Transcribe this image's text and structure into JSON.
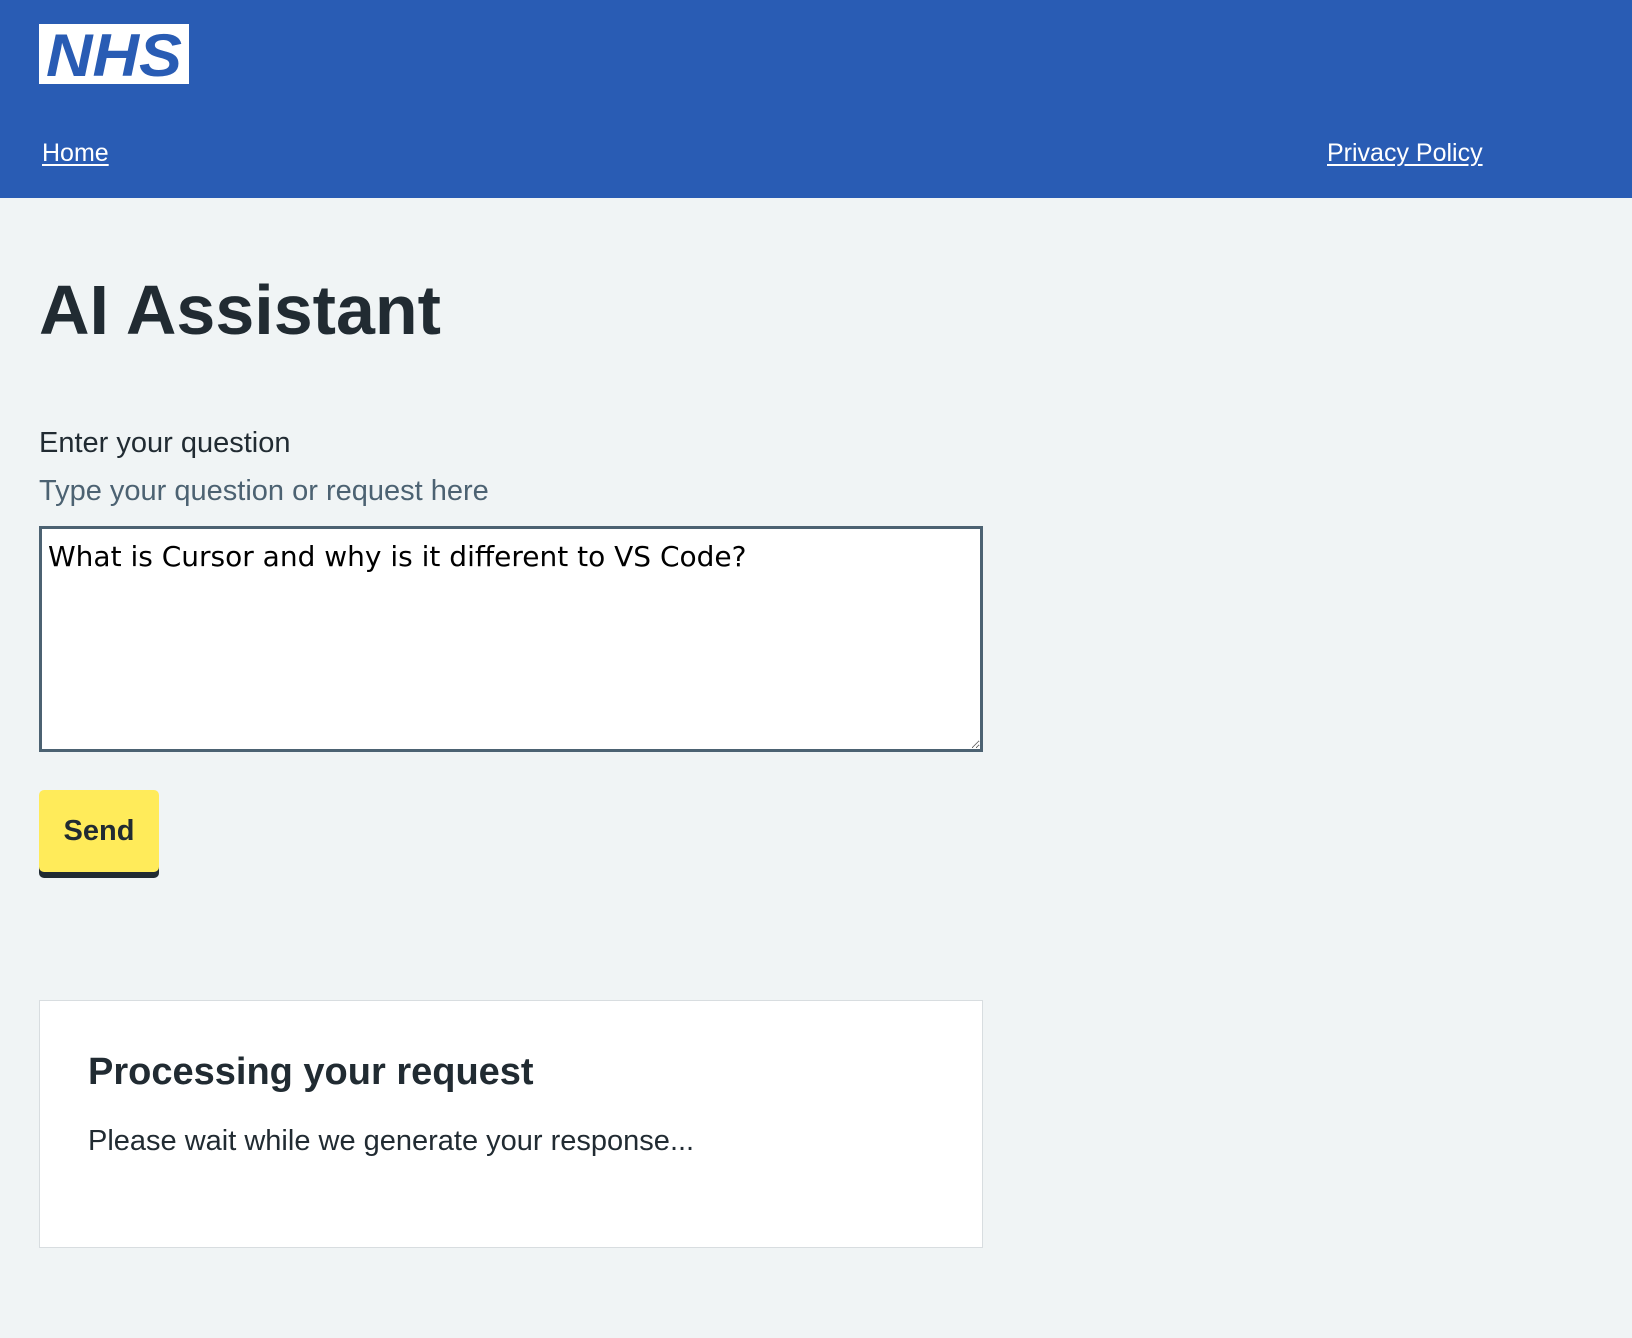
{
  "header": {
    "logo_text": "NHS",
    "nav": {
      "home": "Home",
      "privacy": "Privacy Policy"
    }
  },
  "main": {
    "title": "AI Assistant",
    "form": {
      "label": "Enter your question",
      "hint": "Type your question or request here",
      "question_value": "What is Cursor and why is it different to VS Code?",
      "send_label": "Send"
    },
    "status": {
      "title": "Processing your request",
      "message": "Please wait while we generate your response..."
    }
  },
  "colors": {
    "header_blue": "#295cb4",
    "page_background": "#f0f4f5",
    "button_yellow": "#ffeb5a",
    "text_dark": "#212b32",
    "hint_grey": "#4c6272"
  }
}
